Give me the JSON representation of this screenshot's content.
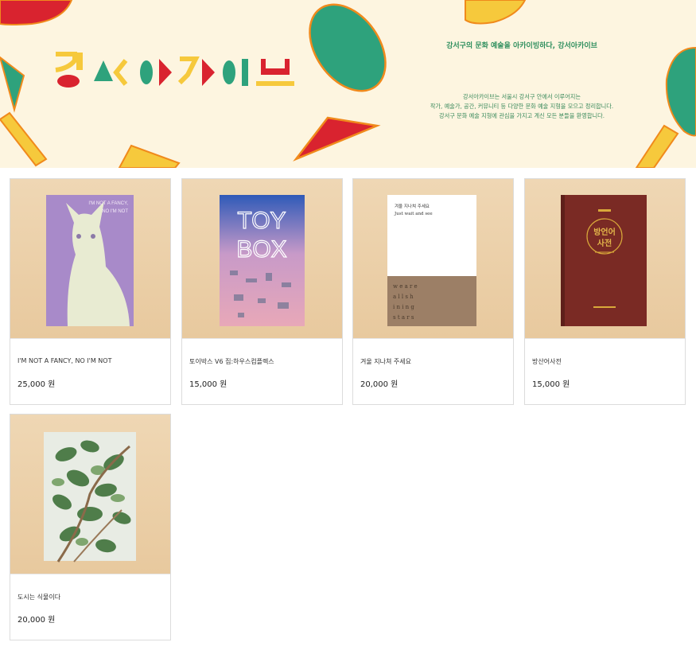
{
  "banner": {
    "logo_alt": "강서아카이브",
    "tagline": "강서구의 문화 예술을 아카이빙하다, 강서아카이브",
    "description_lines": [
      "강서아카이브는 서울시 강서구 안에서 이루어지는",
      "작가, 예술가, 공간, 커뮤니티 등 다양한 문화 예술 지형을 모으고 정리합니다.",
      "강서구 문화 예술 지형에 관심을 가지고 계신 모든 분들을 환영합니다."
    ],
    "colors": {
      "background": "#fdf5e0",
      "green": "#2ea27c",
      "red": "#d9232f",
      "yellow": "#f6c93c",
      "orange_outline": "#f08a1c"
    }
  },
  "products": [
    {
      "name": "I'M NOT A FANCY, NO I'M NOT",
      "price": "25,000 원",
      "cover_text": "I'M NOT A FANCY, NO I'M NOT"
    },
    {
      "name": "토이박스 V6 집:하우스컴플렉스",
      "price": "15,000 원",
      "cover_text": "TOY BOX"
    },
    {
      "name": "겨울 지나쳐 주세요",
      "price": "20,000 원",
      "cover_text": "겨울 지나쳐 주세요 Just wait and see"
    },
    {
      "name": "방산어사전",
      "price": "15,000 원",
      "cover_text": "방언어 사전"
    },
    {
      "name": "도시는 식물이다",
      "price": "20,000 원",
      "cover_text": ""
    }
  ]
}
